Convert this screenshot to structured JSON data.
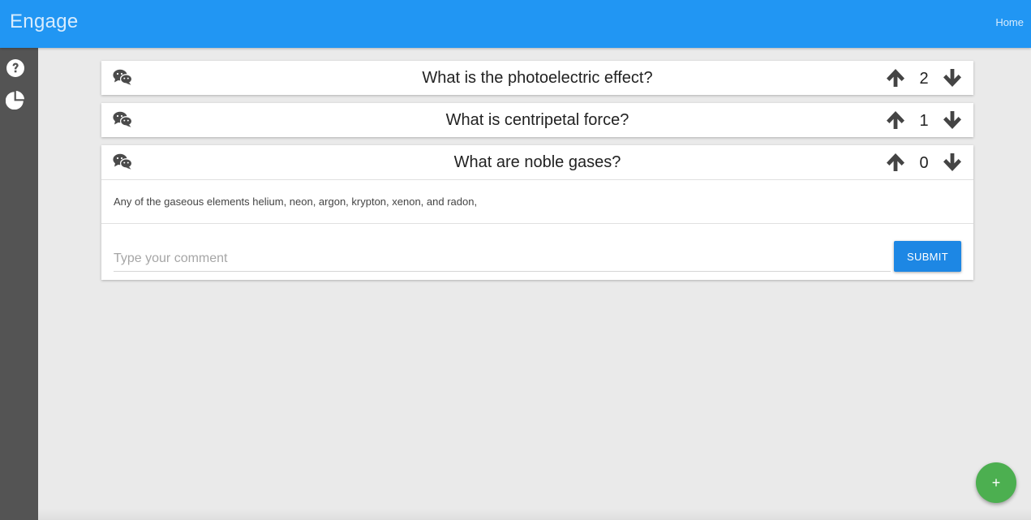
{
  "header": {
    "brand": "Engage",
    "home_link": "Home",
    "bar_color": "#2196f3"
  },
  "sidebar": {
    "items": [
      {
        "icon": "question-circle-icon"
      },
      {
        "icon": "pie-chart-icon"
      }
    ]
  },
  "questions": [
    {
      "title": "What is the photoelectric effect?",
      "votes": "2",
      "icon": "chat-bubbles-icon"
    },
    {
      "title": "What is centripetal force?",
      "votes": "1",
      "icon": "chat-bubbles-icon"
    },
    {
      "title": "What are noble gases?",
      "votes": "0",
      "icon": "chat-bubbles-icon",
      "expanded": true,
      "answer": "Any of the gaseous elements helium, neon, argon, krypton, xenon, and radon,",
      "comment": {
        "value": "",
        "placeholder": "Type your comment",
        "submit_label": "SUBMIT"
      }
    }
  ],
  "fab": {
    "label": "+",
    "color": "#4caf50"
  },
  "colors": {
    "accent": "#2196f3",
    "submit": "#1d87e4",
    "sidebar": "#545454"
  }
}
